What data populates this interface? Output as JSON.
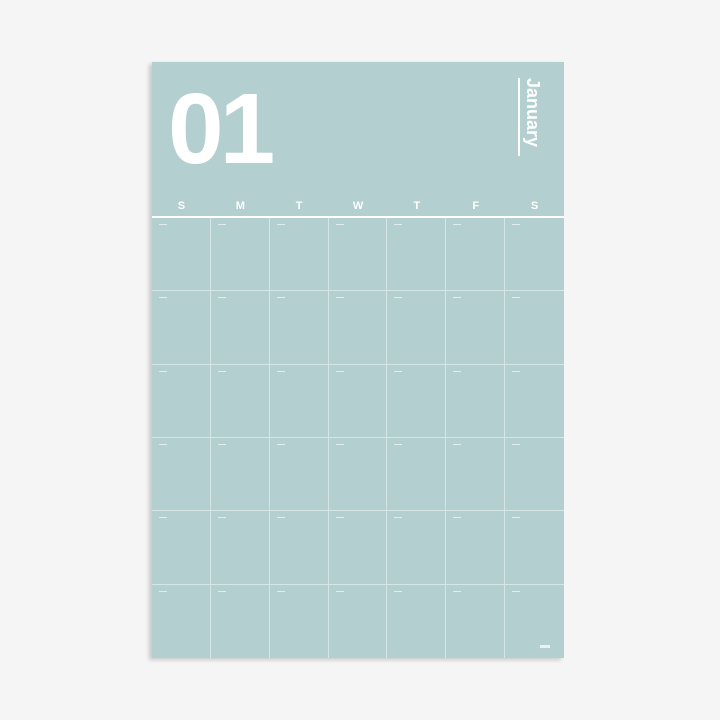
{
  "calendar": {
    "month_number": "01",
    "month_name": "January",
    "weekdays": [
      "S",
      "M",
      "T",
      "W",
      "T",
      "F",
      "S"
    ],
    "weeks": 6,
    "background_color": "#b4cfcf",
    "text_color": "#ffffff"
  }
}
